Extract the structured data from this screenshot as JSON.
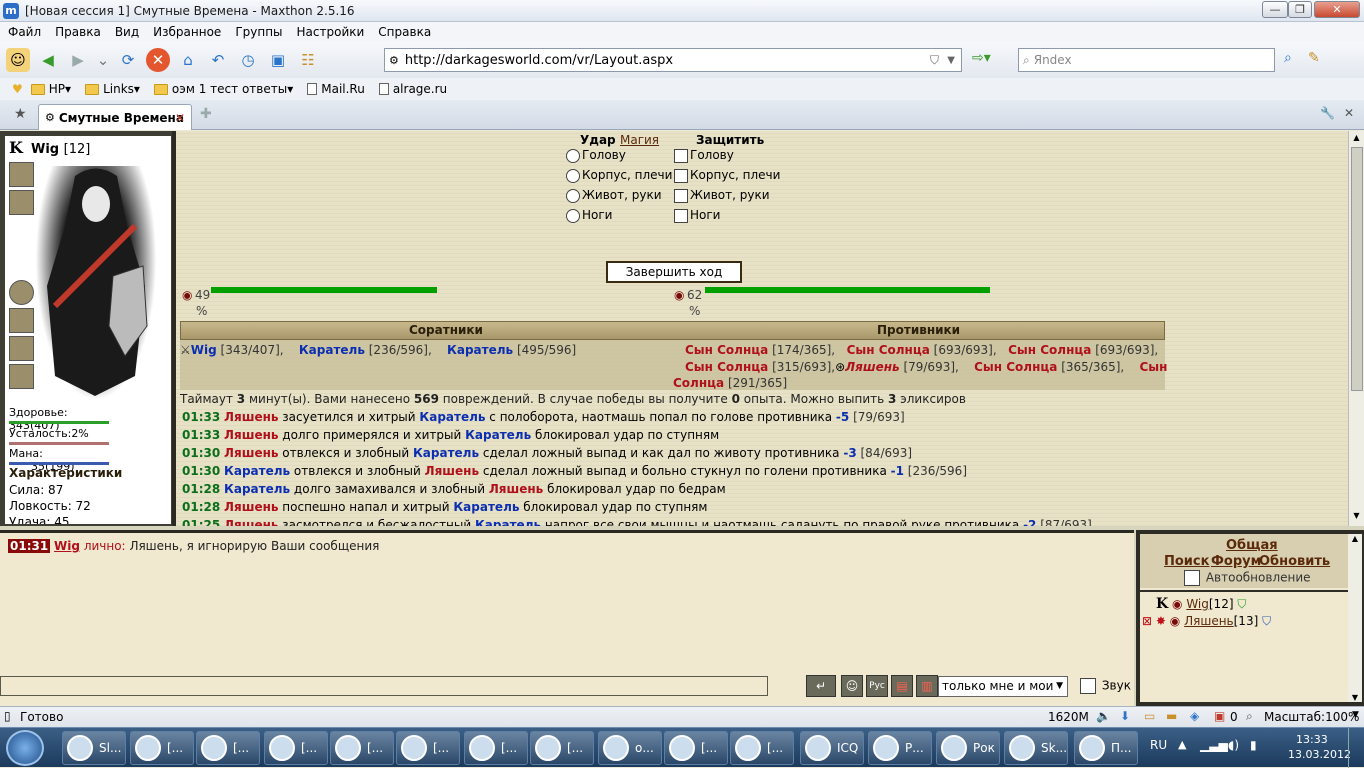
{
  "window": {
    "title": "[Новая сессия 1] Смутные Времена - Maxthon 2.5.16",
    "app_icon": "maxthon-icon"
  },
  "menu": [
    "Файл",
    "Правка",
    "Вид",
    "Избранное",
    "Группы",
    "Настройки",
    "Справка"
  ],
  "toolbar": {
    "address": "http://darkagesworld.com/vr/Layout.aspx",
    "search_placeholder": "Яndex"
  },
  "favorites": [
    {
      "label": "HP",
      "type": "folder-dropdown"
    },
    {
      "label": "Links",
      "type": "folder-dropdown"
    },
    {
      "label": "оэм 1 тест ответы",
      "type": "folder-dropdown"
    },
    {
      "label": "Mail.Ru",
      "type": "page"
    },
    {
      "label": "alrage.ru",
      "type": "page"
    }
  ],
  "tab": {
    "label": "Смутные Времена"
  },
  "character": {
    "name": "Wig",
    "level": "[12]",
    "klan_letter": "K",
    "health_label": "Здоровье:",
    "health_value": "343(407)",
    "fatigue_label": "Усталость:",
    "fatigue_value": "2%",
    "mana_label": "Мана:",
    "mana_value": "35(199)",
    "chars_title": "Характеристики",
    "strength": "Сила: 87",
    "agility": "Ловкость: 72",
    "luck": "Удача: 45"
  },
  "combat": {
    "attack_label": "Удар",
    "magic_label": "Магия",
    "defend_label": "Защитить",
    "zones": [
      "Голову",
      "Корпус, плечи",
      "Живот, руки",
      "Ноги"
    ],
    "end_turn": "Завершить ход",
    "hp_left_value": "49",
    "hp_right_value": "62",
    "percent_sign": "%",
    "allies_header": "Соратники",
    "enemies_header": "Противники"
  },
  "allies": [
    {
      "name": "Wig",
      "hp": "[343/407],"
    },
    {
      "name": "Каратель",
      "hp": "[236/596],"
    },
    {
      "name": "Каратель",
      "hp": "[495/596]"
    }
  ],
  "enemies": [
    {
      "name": "Сын Солнца",
      "hp": "[174/365],"
    },
    {
      "name": "Сын Солнца",
      "hp": "[693/693],"
    },
    {
      "name": "Сын Солнца",
      "hp": "[693/693],"
    },
    {
      "name": "Сын Солнца",
      "hp": "[315/693],"
    },
    {
      "name": "Ляшень",
      "hp": "[79/693],"
    },
    {
      "name": "Сын Солнца",
      "hp": "[365/365],"
    },
    {
      "name": "Сын",
      "hp": ""
    },
    {
      "name": "Солнца",
      "hp": "[291/365]"
    }
  ],
  "summary": {
    "t1": "Таймаут ",
    "t2": "3",
    "t3": " минут(ы). Вами нанесено ",
    "t4": "569",
    "t5": " повреждений. В случае победы вы получите ",
    "t6": "0",
    "t7": " опыта. Можно выпить ",
    "t8": "3",
    "t9": " эликсиров"
  },
  "log": [
    {
      "time": "01:33",
      "a": "Ляшень",
      "a_side": "red",
      "mid": " засуетился и хитрый ",
      "b": "Каратель",
      "b_side": "blue",
      "rest": " с полоборота, наотмашь попал по голове противника ",
      "dmg": "-5",
      "tail": " [79/693]"
    },
    {
      "time": "01:33",
      "a": "Ляшень",
      "a_side": "red",
      "mid": " долго примерялся и хитрый ",
      "b": "Каратель",
      "b_side": "blue",
      "rest": " блокировал удар по ступням",
      "dmg": "",
      "tail": ""
    },
    {
      "time": "01:30",
      "a": "Ляшень",
      "a_side": "red",
      "mid": " отвлекся и злобный ",
      "b": "Каратель",
      "b_side": "blue",
      "rest": " сделал ложный выпад и как дал по животу противника ",
      "dmg": "-3",
      "tail": " [84/693]"
    },
    {
      "time": "01:30",
      "a": "Каратель",
      "a_side": "blue",
      "mid": " отвлекся и злобный ",
      "b": "Ляшень",
      "b_side": "red",
      "rest": " сделал ложный выпад и больно стукнул по голени противника ",
      "dmg": "-1",
      "tail": " [236/596]"
    },
    {
      "time": "01:28",
      "a": "Каратель",
      "a_side": "blue",
      "mid": " долго замахивался и злобный ",
      "b": "Ляшень",
      "b_side": "red",
      "rest": " блокировал удар по бедрам",
      "dmg": "",
      "tail": ""
    },
    {
      "time": "01:28",
      "a": "Ляшень",
      "a_side": "red",
      "mid": " поспешно напал и хитрый ",
      "b": "Каратель",
      "b_side": "blue",
      "rest": " блокировал удар по ступням",
      "dmg": "",
      "tail": ""
    },
    {
      "time": "01:25",
      "a": "Ляшень",
      "a_side": "red",
      "mid": " засмотрелся и бесжалостный ",
      "b": "Каратель",
      "b_side": "blue",
      "rest": " напрог все свои мышцы и наотмашь садануть по правой руке противника ",
      "dmg": "-2",
      "tail": " [87/693]"
    }
  ],
  "chat": {
    "time": "01:31",
    "sender": "Wig",
    "private_label": "лично:",
    "message": "Ляшень, я игнорирую Ваши сообщения",
    "filter_value": "только мне и мои",
    "sound_label": "Звук"
  },
  "side": {
    "general": "Общая",
    "search": "Поиск",
    "forum": "Форум",
    "refresh": "Обновить",
    "autorefresh": "Автообновление",
    "players": [
      {
        "name": "Wig",
        "level": "[12]",
        "klan": "K"
      },
      {
        "name": "Ляшень",
        "level": "[13]",
        "klan": ""
      }
    ]
  },
  "status": {
    "ready": "Готово",
    "memory": "1620M",
    "counter": "0",
    "zoom": "Масштаб:100%"
  },
  "taskbar": {
    "items": [
      "Sl...",
      "[...",
      "[...",
      "[...",
      "[...",
      "[...",
      "[...",
      "[...",
      "о...",
      "[...",
      "[...",
      "ICQ",
      "Р...",
      "Рок",
      "Sk...",
      "П..."
    ],
    "lang": "RU",
    "time": "13:33",
    "date": "13.03.2012"
  },
  "colors": {
    "accent_blue": "#0c2fb1",
    "enemy_red": "#b0101a",
    "log_time_green": "#0b6e1a",
    "hp_bar": "#00a000"
  }
}
